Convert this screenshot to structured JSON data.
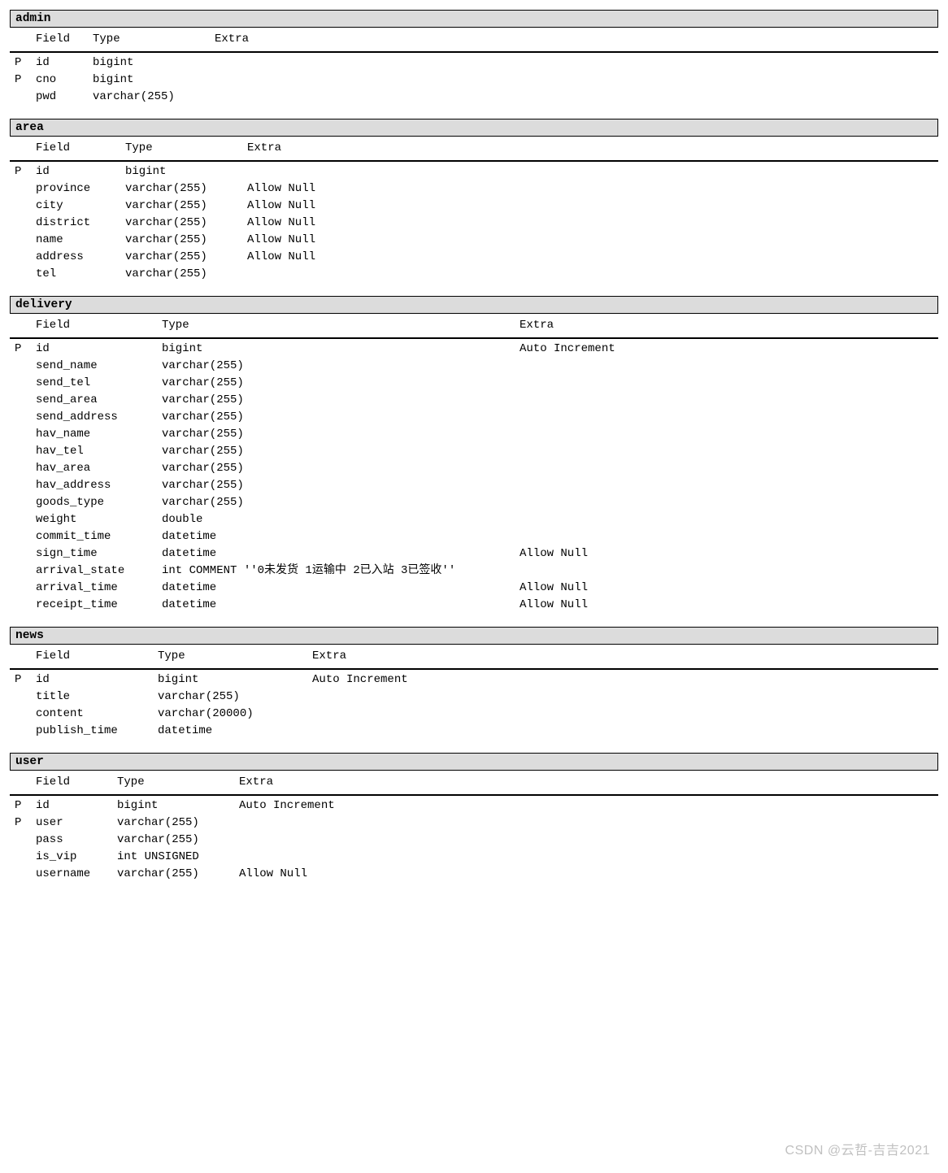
{
  "headers": {
    "pk": "P",
    "field": "Field",
    "type": "Type",
    "extra": "Extra"
  },
  "tables": [
    {
      "name": "admin",
      "col_widths": {
        "field": 70,
        "type": 150
      },
      "fields": [
        {
          "pk": "P",
          "field": "id",
          "type": "bigint",
          "extra": ""
        },
        {
          "pk": "P",
          "field": "cno",
          "type": "bigint",
          "extra": ""
        },
        {
          "pk": "",
          "field": "pwd",
          "type": "varchar(255)",
          "extra": ""
        }
      ]
    },
    {
      "name": "area",
      "col_widths": {
        "field": 110,
        "type": 150
      },
      "fields": [
        {
          "pk": "P",
          "field": "id",
          "type": "bigint",
          "extra": ""
        },
        {
          "pk": "",
          "field": "province",
          "type": "varchar(255)",
          "extra": "Allow Null"
        },
        {
          "pk": "",
          "field": "city",
          "type": "varchar(255)",
          "extra": "Allow Null"
        },
        {
          "pk": "",
          "field": "district",
          "type": "varchar(255)",
          "extra": "Allow Null"
        },
        {
          "pk": "",
          "field": "name",
          "type": "varchar(255)",
          "extra": "Allow Null"
        },
        {
          "pk": "",
          "field": "address",
          "type": "varchar(255)",
          "extra": "Allow Null"
        },
        {
          "pk": "",
          "field": "tel",
          "type": "varchar(255)",
          "extra": ""
        }
      ]
    },
    {
      "name": "delivery",
      "col_widths": {
        "field": 155,
        "type": 440
      },
      "fields": [
        {
          "pk": "P",
          "field": "id",
          "type": "bigint",
          "extra": "Auto Increment"
        },
        {
          "pk": "",
          "field": "send_name",
          "type": "varchar(255)",
          "extra": ""
        },
        {
          "pk": "",
          "field": "send_tel",
          "type": "varchar(255)",
          "extra": ""
        },
        {
          "pk": "",
          "field": "send_area",
          "type": "varchar(255)",
          "extra": ""
        },
        {
          "pk": "",
          "field": "send_address",
          "type": "varchar(255)",
          "extra": ""
        },
        {
          "pk": "",
          "field": "hav_name",
          "type": "varchar(255)",
          "extra": ""
        },
        {
          "pk": "",
          "field": "hav_tel",
          "type": "varchar(255)",
          "extra": ""
        },
        {
          "pk": "",
          "field": "hav_area",
          "type": "varchar(255)",
          "extra": ""
        },
        {
          "pk": "",
          "field": "hav_address",
          "type": "varchar(255)",
          "extra": ""
        },
        {
          "pk": "",
          "field": "goods_type",
          "type": "varchar(255)",
          "extra": ""
        },
        {
          "pk": "",
          "field": "weight",
          "type": "double",
          "extra": ""
        },
        {
          "pk": "",
          "field": "commit_time",
          "type": "datetime",
          "extra": ""
        },
        {
          "pk": "",
          "field": "sign_time",
          "type": "datetime",
          "extra": "Allow Null"
        },
        {
          "pk": "",
          "field": "arrival_state",
          "type": "int COMMENT ''0未发货 1运输中 2已入站 3已签收''",
          "extra": ""
        },
        {
          "pk": "",
          "field": "arrival_time",
          "type": "datetime",
          "extra": "Allow Null"
        },
        {
          "pk": "",
          "field": "receipt_time",
          "type": "datetime",
          "extra": "Allow Null"
        }
      ]
    },
    {
      "name": "news",
      "col_widths": {
        "field": 150,
        "type": 190
      },
      "fields": [
        {
          "pk": "P",
          "field": "id",
          "type": "bigint",
          "extra": "Auto Increment"
        },
        {
          "pk": "",
          "field": "title",
          "type": "varchar(255)",
          "extra": ""
        },
        {
          "pk": "",
          "field": "content",
          "type": "varchar(20000)",
          "extra": ""
        },
        {
          "pk": "",
          "field": "publish_time",
          "type": "datetime",
          "extra": ""
        }
      ]
    },
    {
      "name": "user",
      "col_widths": {
        "field": 100,
        "type": 150
      },
      "fields": [
        {
          "pk": "P",
          "field": "id",
          "type": "bigint",
          "extra": "Auto Increment"
        },
        {
          "pk": "P",
          "field": "user",
          "type": "varchar(255)",
          "extra": ""
        },
        {
          "pk": "",
          "field": "pass",
          "type": "varchar(255)",
          "extra": ""
        },
        {
          "pk": "",
          "field": "is_vip",
          "type": "int UNSIGNED",
          "extra": ""
        },
        {
          "pk": "",
          "field": "username",
          "type": "varchar(255)",
          "extra": "Allow Null"
        }
      ]
    }
  ],
  "watermark": "CSDN @云哲-吉吉2021"
}
